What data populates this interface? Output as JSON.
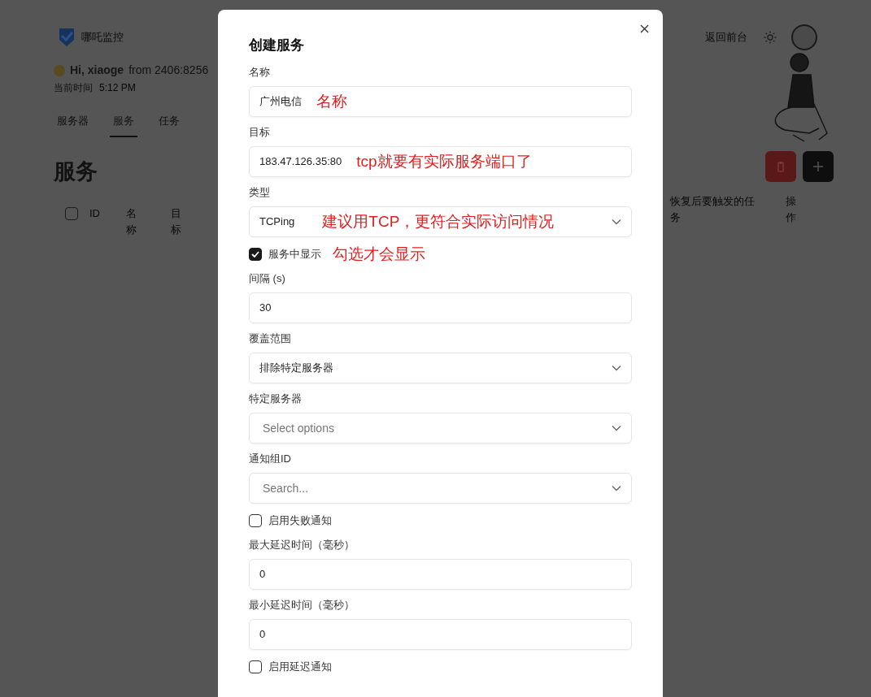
{
  "app": {
    "logo_text": "哪吒监控",
    "back_link": "返回前台"
  },
  "greeting": {
    "hi": "Hi, xiaoge",
    "from": "from 2406:8256",
    "time_label": "当前时间",
    "time": "5:12 PM"
  },
  "tabs": [
    {
      "label": "服务器",
      "selected": false
    },
    {
      "label": "服务",
      "selected": true
    },
    {
      "label": "任务",
      "selected": false
    }
  ],
  "page_title": "服务",
  "table": {
    "select_all_checked": false,
    "columns_left": [
      "ID",
      "名称",
      "目标"
    ],
    "columns_right": [
      "恢复后要触发的任务",
      "操作"
    ]
  },
  "dialog": {
    "title": "创建服务",
    "fields": [
      {
        "kind": "text",
        "label": "名称",
        "value": "广州电信",
        "annotation": "名称"
      },
      {
        "kind": "text",
        "label": "目标",
        "value": "183.47.126.35:80",
        "annotation": "tcp就要有实际服务端口了"
      },
      {
        "kind": "select",
        "label": "类型",
        "value": "TCPing",
        "annotation": "建议用TCP，更符合实际访问情况"
      },
      {
        "kind": "checkbox",
        "label": "服务中显示",
        "checked": true,
        "annotation": "勾选才会显示"
      },
      {
        "kind": "text",
        "label": "间隔 (s)",
        "value": "30"
      },
      {
        "kind": "select",
        "label": "覆盖范围",
        "value": "排除特定服务器"
      },
      {
        "kind": "select",
        "label": "特定服务器",
        "placeholder": "Select options"
      },
      {
        "kind": "select",
        "label": "通知组ID",
        "placeholder": "Search..."
      },
      {
        "kind": "checkbox",
        "label": "启用失败通知",
        "checked": false
      },
      {
        "kind": "text",
        "label": "最大延迟时间（毫秒）",
        "value": "0"
      },
      {
        "kind": "text",
        "label": "最小延迟时间（毫秒）",
        "value": "0"
      },
      {
        "kind": "checkbox",
        "label": "启用延迟通知",
        "checked": false
      }
    ]
  }
}
